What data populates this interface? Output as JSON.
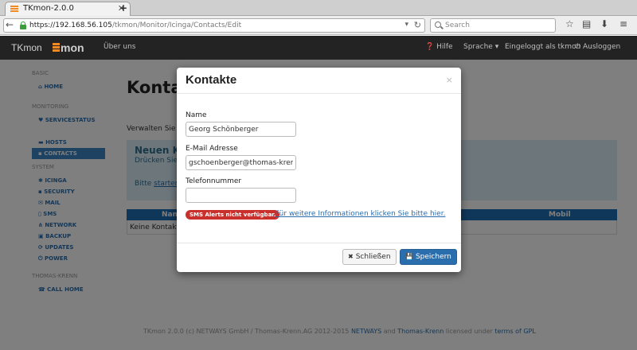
{
  "browser": {
    "tab_title": "TKmon-2.0.0",
    "url_host": "https://192.168.56.105",
    "url_path": "/tkmon/Monitor/Icinga/Contacts/Edit",
    "search_placeholder": "Search"
  },
  "app": {
    "brand": "TKmon",
    "logo_text": "mon",
    "nav_about": "Über uns",
    "nav_help": "Hilfe",
    "nav_language": "Sprache",
    "nav_user": "Eingeloggt als tkmon",
    "nav_logout": "Ausloggen"
  },
  "sidebar": {
    "sections": [
      {
        "heading": "BASIC",
        "items": [
          {
            "label": "HOME"
          }
        ]
      },
      {
        "heading": "MONITORING",
        "items": [
          {
            "label": "SERVICESTATUS"
          },
          {
            "label": "HOSTS"
          },
          {
            "label": "CONTACTS",
            "active": true
          }
        ]
      },
      {
        "heading": "SYSTEM",
        "items": [
          {
            "label": "ICINGA"
          },
          {
            "label": "SECURITY"
          },
          {
            "label": "MAIL"
          },
          {
            "label": "SMS"
          },
          {
            "label": "NETWORK"
          },
          {
            "label": "BACKUP"
          },
          {
            "label": "UPDATES"
          },
          {
            "label": "POWER"
          }
        ]
      },
      {
        "heading": "THOMAS-KRENN",
        "items": [
          {
            "label": "CALL HOME"
          }
        ]
      }
    ]
  },
  "page": {
    "title": "Kontakte",
    "subtitle": "Verwalten Sie hi",
    "info_title": "Neuen Ko",
    "info_text": "Drücken Sie",
    "info_link_prefix": "Bitte ",
    "info_link": "starten",
    "table_headers": [
      "Name",
      "Mobil"
    ],
    "empty_row": "Keine Kontakte",
    "footer_prefix": "TKmon 2.0.0 (c) NETWAYS GmbH / Thomas-Krenn.AG 2012-2015 ",
    "footer_netways": "NETWAYS",
    "footer_and": " and ",
    "footer_tk": "Thomas-Krenn",
    "footer_licensed": " licensed under ",
    "footer_gpl": "terms of GPL"
  },
  "modal": {
    "title": "Kontakte",
    "close_glyph": "×",
    "name_label": "Name",
    "name_value": "Georg Schönberger",
    "email_label": "E-Mail Adresse",
    "email_value": "gschoenberger@thomas-krenn.c",
    "phone_label": "Telefonnummer",
    "phone_value": "",
    "sms_badge": "SMS Alerts nicht verfügbar.",
    "sms_link": "Für weitere Informationen klicken Sie bitte hier.",
    "close_button": "Schließen",
    "save_button": "Speichern"
  },
  "colors": {
    "accent": "#2a6eae",
    "danger": "#c9302c",
    "header_bg": "#232323",
    "logo_orange": "#f08a24"
  }
}
